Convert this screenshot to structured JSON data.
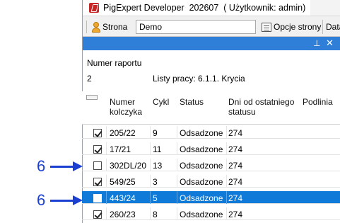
{
  "window": {
    "title": "PigExpert Developer  202607  ( Użytkownik: admin)"
  },
  "toolbar": {
    "strona_label": "Strona",
    "strona_value": "Demo",
    "opcje_label": "Opcje strony",
    "data_label": "Data"
  },
  "panel": {
    "pin_glyph": "⊥",
    "close_glyph": "✕",
    "report_label": "Numer raportu",
    "report_number": "2",
    "report_list": "Listy pracy: 6.1.1. Krycia"
  },
  "grid": {
    "headers": {
      "numer_line1": "Numer",
      "numer_line2": "kolczyka",
      "cykl": "Cykl",
      "status": "Status",
      "dni_line1": "Dni od ostatniego",
      "dni_line2": "statusu",
      "podlinia": "Podlinia"
    },
    "rows": [
      {
        "checked": true,
        "numer": "205/22",
        "cykl": "9",
        "status": "Odsadzone",
        "dni": "274"
      },
      {
        "checked": true,
        "numer": "17/21",
        "cykl": "11",
        "status": "Odsadzone",
        "dni": "274"
      },
      {
        "checked": false,
        "numer": "302DL/20",
        "cykl": "13",
        "status": "Odsadzone",
        "dni": "274"
      },
      {
        "checked": true,
        "numer": "549/25",
        "cykl": "3",
        "status": "Odsadzone",
        "dni": "274"
      },
      {
        "checked": false,
        "numer": "443/24",
        "cykl": "5",
        "status": "Odsadzone",
        "dni": "274",
        "selected": true
      },
      {
        "checked": true,
        "numer": "260/23",
        "cykl": "8",
        "status": "Odsadzone",
        "dni": "274"
      }
    ]
  },
  "annotations": [
    {
      "label": "6",
      "color": "#1a3fd1"
    },
    {
      "label": "6",
      "color": "#1a3fd1"
    }
  ]
}
